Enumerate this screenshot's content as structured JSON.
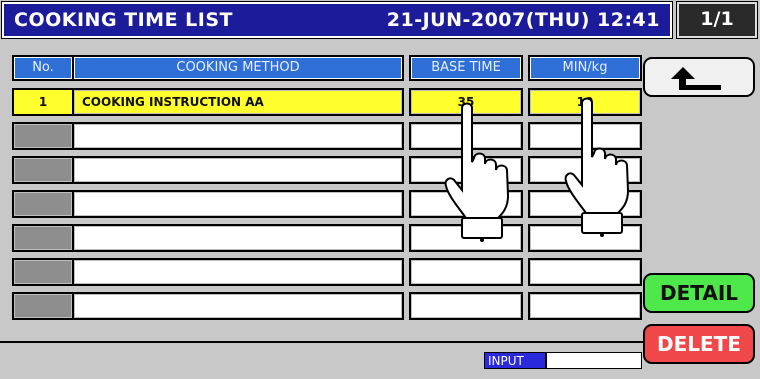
{
  "header": {
    "title": "COOKING TIME LIST",
    "datetime": "21-JUN-2007(THU) 12:41",
    "page": "1/1"
  },
  "columns": {
    "no": "No.",
    "method": "COOKING METHOD",
    "base_time": "BASE TIME",
    "min_per_kg": "MIN/kg"
  },
  "rows": [
    {
      "no": "1",
      "method": "COOKING INSTRUCTION AA",
      "base_time": "35",
      "min_per_kg": "10"
    },
    {
      "no": "",
      "method": "",
      "base_time": "",
      "min_per_kg": ""
    },
    {
      "no": "",
      "method": "",
      "base_time": "",
      "min_per_kg": ""
    },
    {
      "no": "",
      "method": "",
      "base_time": "",
      "min_per_kg": ""
    },
    {
      "no": "",
      "method": "",
      "base_time": "",
      "min_per_kg": ""
    },
    {
      "no": "",
      "method": "",
      "base_time": "",
      "min_per_kg": ""
    },
    {
      "no": "",
      "method": "",
      "base_time": "",
      "min_per_kg": ""
    }
  ],
  "buttons": {
    "back_icon": "back-arrow-icon",
    "detail": "DETAIL",
    "delete": "DELETE"
  },
  "input": {
    "label": "INPUT",
    "value": ""
  },
  "colors": {
    "title_bar": "#1c1c9a",
    "header_cell": "#2e6fd8",
    "highlight_row": "#ffff2e",
    "detail_button": "#4ee84a",
    "delete_button": "#f04848"
  }
}
